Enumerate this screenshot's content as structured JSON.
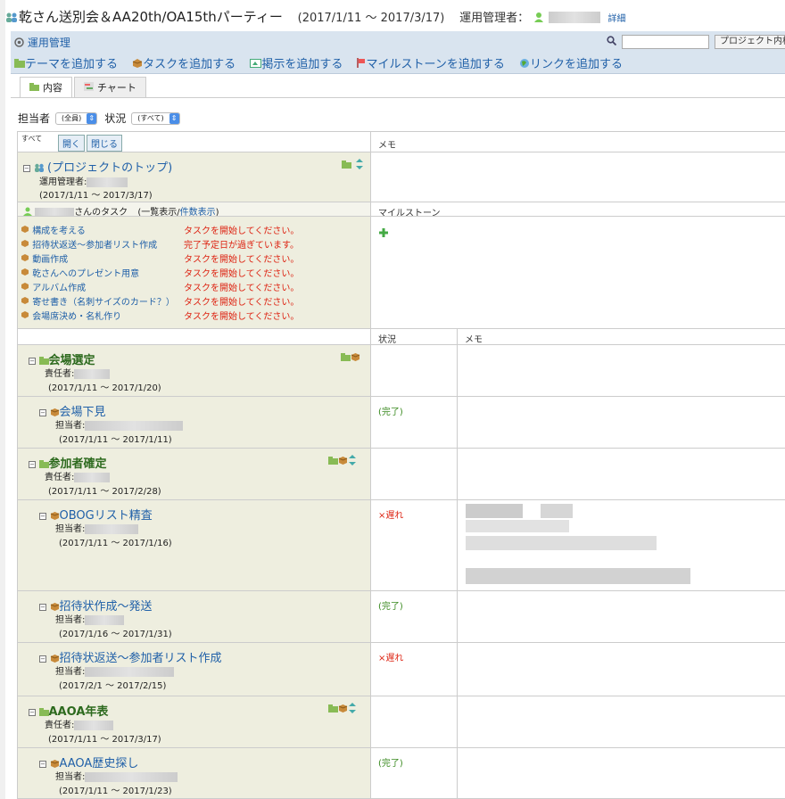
{
  "header": {
    "title": "乾さん送別会＆AA20th/OA15thパーティー",
    "period": "(2017/1/11 ～ 2017/3/17)",
    "manager_label": "運用管理者：",
    "detail_link": "詳細"
  },
  "toolbar": {
    "admin_label": "運用管理",
    "actions": [
      "テーマを追加する",
      "タスクを追加する",
      "掲示を追加する",
      "マイルストーンを追加する",
      "リンクを追加する"
    ],
    "search_placeholder": "",
    "search_button": "プロジェクト内検索"
  },
  "tabs": [
    "内容",
    "チャート"
  ],
  "filter": {
    "assignee_label": "担当者",
    "assignee_value": "(全員)",
    "status_label": "状況",
    "status_value": "(すべて)"
  },
  "grid": {
    "all_label": "すべて",
    "open_button": "開く",
    "close_button": "閉じる",
    "memo_header": "メモ",
    "top": {
      "name": "(プロジェクトのトップ)",
      "manager_label": "運用管理者:",
      "period": "(2017/1/11 ～ 2017/3/17)"
    },
    "tasks_header": {
      "suffix": "さんのタスク",
      "paren_open": "(",
      "list_view": "一覧表示",
      "slash": "/",
      "count_view": "件数表示",
      "paren_close": ")"
    },
    "milestone_header": "マイルストーン",
    "my_tasks": [
      {
        "name": "構成を考える",
        "status": "タスクを開始してください。"
      },
      {
        "name": "招待状返送〜参加者リスト作成",
        "status": "完了予定日が過ぎています。"
      },
      {
        "name": "動画作成",
        "status": "タスクを開始してください。"
      },
      {
        "name": "乾さんへのプレゼント用意",
        "status": "タスクを開始してください。"
      },
      {
        "name": "アルバム作成",
        "status": "タスクを開始してください。"
      },
      {
        "name": "寄せ書き（名刺サイズのカード？）",
        "status": "タスクを開始してください。"
      },
      {
        "name": "会場席決め・名札作り",
        "status": "タスクを開始してください。"
      }
    ],
    "status_header": "状況",
    "memo_header2": "メモ",
    "rows": [
      {
        "kind": "theme",
        "name": "会場選定",
        "role": "責任者:",
        "period": "(2017/1/11 ～ 2017/1/20)",
        "status": ""
      },
      {
        "kind": "task",
        "name": "会場下見",
        "role": "担当者:",
        "period": "(2017/1/11 ～ 2017/1/11)",
        "status": "(完了)"
      },
      {
        "kind": "theme",
        "name": "参加者確定",
        "role": "責任者:",
        "period": "(2017/1/11 ～ 2017/2/28)",
        "status": ""
      },
      {
        "kind": "task",
        "name": "OBOGリスト精査",
        "role": "担当者:",
        "period": "(2017/1/11 ～ 2017/1/16)",
        "status": "×遅れ"
      },
      {
        "kind": "task",
        "name": "招待状作成〜発送",
        "role": "担当者:",
        "period": "(2017/1/16 ～ 2017/1/31)",
        "status": "(完了)"
      },
      {
        "kind": "task",
        "name": "招待状返送〜参加者リスト作成",
        "role": "担当者:",
        "period": "(2017/2/1 ～ 2017/2/15)",
        "status": "×遅れ"
      },
      {
        "kind": "theme",
        "name": "AAOA年表",
        "role": "責任者:",
        "period": "(2017/1/11 ～ 2017/3/17)",
        "status": ""
      },
      {
        "kind": "task",
        "name": "AAOA歴史探し",
        "role": "担当者:",
        "period": "(2017/1/11 ～ 2017/1/23)",
        "status": "(完了)"
      }
    ]
  }
}
